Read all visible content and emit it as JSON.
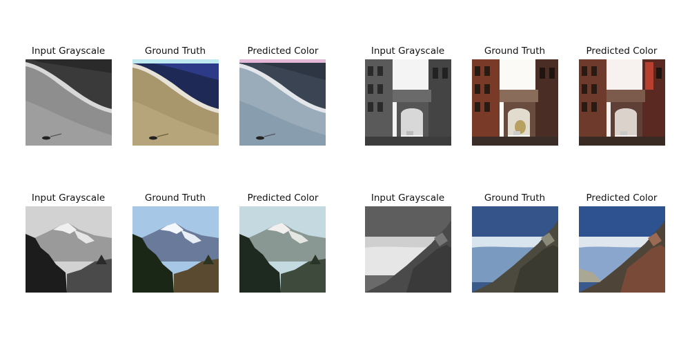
{
  "titles": {
    "input": "Input Grayscale",
    "truth": "Ground Truth",
    "pred": "Predicted Color"
  },
  "scenes": [
    {
      "name": "beach",
      "panels": [
        "input-grayscale",
        "ground-truth",
        "predicted-color"
      ]
    },
    {
      "name": "arched-street",
      "panels": [
        "input-grayscale",
        "ground-truth",
        "predicted-color"
      ]
    },
    {
      "name": "snowy-mountain",
      "panels": [
        "input-grayscale",
        "ground-truth",
        "predicted-color"
      ]
    },
    {
      "name": "cliff-above-clouds",
      "panels": [
        "input-grayscale",
        "ground-truth",
        "predicted-color"
      ]
    }
  ]
}
